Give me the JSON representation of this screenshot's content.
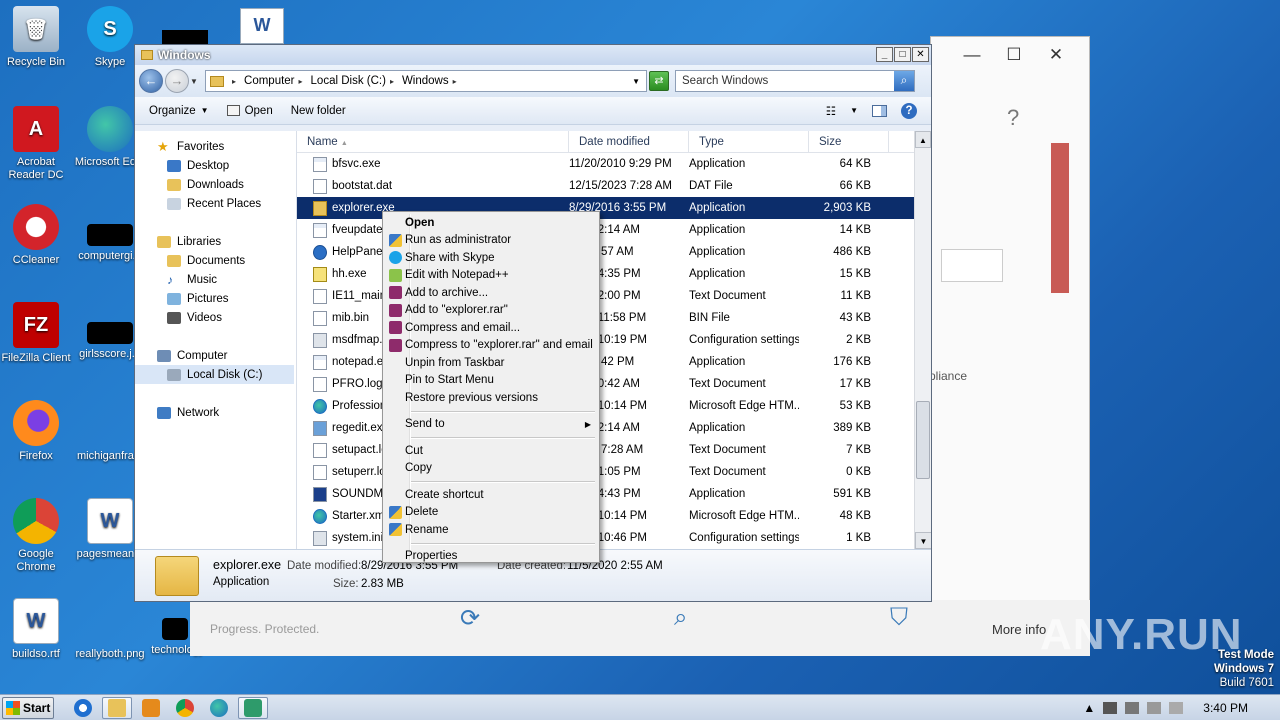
{
  "desktop": {
    "icons": [
      {
        "label": "Recycle Bin"
      },
      {
        "label": "Skype"
      },
      {
        "label": "Acrobat Reader DC"
      },
      {
        "label": "Microsoft Ed..."
      },
      {
        "label": "CCleaner"
      },
      {
        "label": "computergi..."
      },
      {
        "label": "FileZilla Client"
      },
      {
        "label": "girlsscore.j..."
      },
      {
        "label": "Firefox"
      },
      {
        "label": "michiganfra..."
      },
      {
        "label": "Google Chrome"
      },
      {
        "label": "pagesmean..."
      },
      {
        "label": "buildso.rtf"
      },
      {
        "label": "reallyboth.png"
      },
      {
        "label": "technology..."
      }
    ]
  },
  "background_app": {
    "help": "?",
    "compliance": "pliance",
    "progress_text": "Progress. Protected.",
    "more_info": "More info"
  },
  "explorer": {
    "title": "Windows",
    "address": {
      "crumbs": [
        "Computer",
        "Local Disk (C:)",
        "Windows"
      ]
    },
    "search_placeholder": "Search Windows",
    "toolbar": {
      "organize": "Organize",
      "open": "Open",
      "new_folder": "New folder"
    },
    "nav": {
      "favorites": "Favorites",
      "desktop": "Desktop",
      "downloads": "Downloads",
      "recent": "Recent Places",
      "libraries": "Libraries",
      "documents": "Documents",
      "music": "Music",
      "pictures": "Pictures",
      "videos": "Videos",
      "computer": "Computer",
      "local_disk": "Local Disk (C:)",
      "network": "Network"
    },
    "columns": {
      "name": "Name",
      "date": "Date modified",
      "type": "Type",
      "size": "Size"
    },
    "files": [
      {
        "name": "bfsvc.exe",
        "date": "11/20/2010 9:29 PM",
        "type": "Application",
        "size": "64 KB"
      },
      {
        "name": "bootstat.dat",
        "date": "12/15/2023 7:28 AM",
        "type": "DAT File",
        "size": "66 KB"
      },
      {
        "name": "explorer.exe",
        "date": "8/29/2016 3:55 PM",
        "type": "Application",
        "size": "2,903 KB"
      },
      {
        "name": "fveupdate.exe",
        "date": "2009 2:14 AM",
        "type": "Application",
        "size": "14 KB"
      },
      {
        "name": "HelpPane.exe",
        "date": "017 8:57 AM",
        "type": "Application",
        "size": "486 KB"
      },
      {
        "name": "hh.exe",
        "date": "2018 4:35 PM",
        "type": "Application",
        "size": "15 KB"
      },
      {
        "name": "IE11_main.log",
        "date": "2019 2:00 PM",
        "type": "Text Document",
        "size": "11 KB"
      },
      {
        "name": "mib.bin",
        "date": "2009 11:58 PM",
        "type": "BIN File",
        "size": "43 KB"
      },
      {
        "name": "msdfmap.ini",
        "date": "2009 10:19 PM",
        "type": "Configuration settings",
        "size": "2 KB"
      },
      {
        "name": "notepad.exe",
        "date": "015 6:42 PM",
        "type": "Application",
        "size": "176 KB"
      },
      {
        "name": "PFRO.log",
        "date": "023 10:42 AM",
        "type": "Text Document",
        "size": "17 KB"
      },
      {
        "name": "Professional.xml",
        "date": "2009 10:14 PM",
        "type": "Microsoft Edge HTM...",
        "size": "53 KB"
      },
      {
        "name": "regedit.exe",
        "date": "2009 2:14 AM",
        "type": "Application",
        "size": "389 KB"
      },
      {
        "name": "setupact.log",
        "date": "/2023 7:28 AM",
        "type": "Text Document",
        "size": "7 KB"
      },
      {
        "name": "setuperr.log",
        "date": "2019 1:05 PM",
        "type": "Text Document",
        "size": "0 KB"
      },
      {
        "name": "SOUNDMAN.EXE",
        "date": "2009 4:43 PM",
        "type": "Application",
        "size": "591 KB"
      },
      {
        "name": "Starter.xml",
        "date": "2009 10:14 PM",
        "type": "Microsoft Edge HTM...",
        "size": "48 KB"
      },
      {
        "name": "system.ini",
        "date": "2009 10:46 PM",
        "type": "Configuration settings",
        "size": "1 KB"
      }
    ],
    "details": {
      "name": "explorer.exe",
      "type": "Application",
      "date_modified_label": "Date modified:",
      "date_modified": "8/29/2016 3:55 PM",
      "date_created_label": "Date created:",
      "date_created": "11/5/2020 2:55 AM",
      "size_label": "Size:",
      "size": "2.83 MB"
    }
  },
  "context_menu": {
    "open": "Open",
    "run_admin": "Run as administrator",
    "share_skype": "Share with Skype",
    "edit_npp": "Edit with Notepad++",
    "add_archive": "Add to archive...",
    "add_rar": "Add to \"explorer.rar\"",
    "compress_email": "Compress and email...",
    "compress_rar_email": "Compress to \"explorer.rar\" and email",
    "unpin_taskbar": "Unpin from Taskbar",
    "pin_start": "Pin to Start Menu",
    "restore_versions": "Restore previous versions",
    "send_to": "Send to",
    "cut": "Cut",
    "copy": "Copy",
    "create_shortcut": "Create shortcut",
    "delete": "Delete",
    "rename": "Rename",
    "properties": "Properties"
  },
  "taskbar": {
    "start": "Start",
    "clock": "3:40 PM"
  },
  "watermark": {
    "brand": "ANY.RUN",
    "test_mode": "Test Mode",
    "os": "Windows 7",
    "build": "Build 7601"
  }
}
